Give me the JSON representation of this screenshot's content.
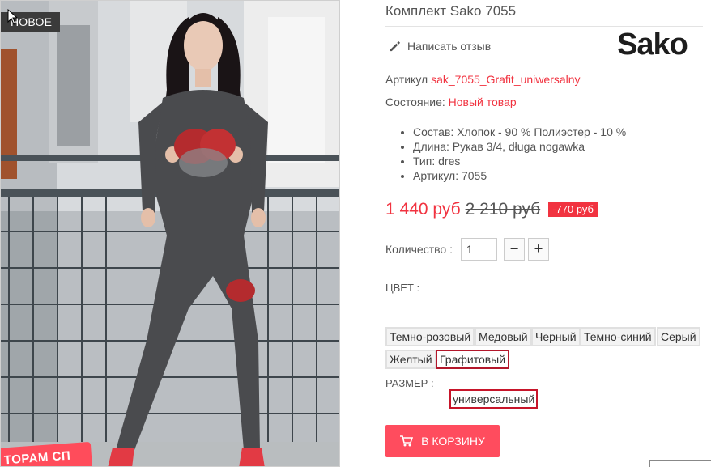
{
  "product": {
    "title": "Комплект Sako 7055",
    "badge": "НОВОЕ",
    "promo_strip": "ТОРАМ СП",
    "review_label": "Написать отзыв",
    "brand_logo_text": "Sako",
    "sku_label": "Артикул",
    "sku_value": "sak_7055_Grafit_uniwersalny",
    "condition_label": "Состояние:",
    "condition_value": "Новый товар",
    "features": [
      "Состав: Хлопок - 90 % Полиэстер - 10 %",
      "Длина: Рукав 3/4, długa nogawka",
      "Тип: dres",
      "Артикул: 7055"
    ]
  },
  "price": {
    "current": "1 440 руб",
    "old": "2 210 руб",
    "discount": "-770 руб"
  },
  "quantity": {
    "label": "Количество :",
    "value": "1",
    "minus_label": "−",
    "plus_label": "+"
  },
  "color": {
    "label": "ЦВЕТ :",
    "options": [
      "Темно-розовый",
      "Медовый",
      "Черный",
      "Темно-синий",
      "Серый",
      "Желтый",
      "Графитовый"
    ],
    "selected": "Графитовый"
  },
  "size": {
    "label": "РАЗМЕР :",
    "option": "универсальный"
  },
  "cart": {
    "label": "В КОРЗИНУ"
  },
  "colors": {
    "accent": "#f13340",
    "button": "#ff4c5e",
    "selected_border": "#b3172b",
    "badge_bg": "#3b3b3b"
  },
  "icons": {
    "review": "pencil-icon",
    "cart": "cart-icon",
    "cursor": "cursor-icon"
  }
}
